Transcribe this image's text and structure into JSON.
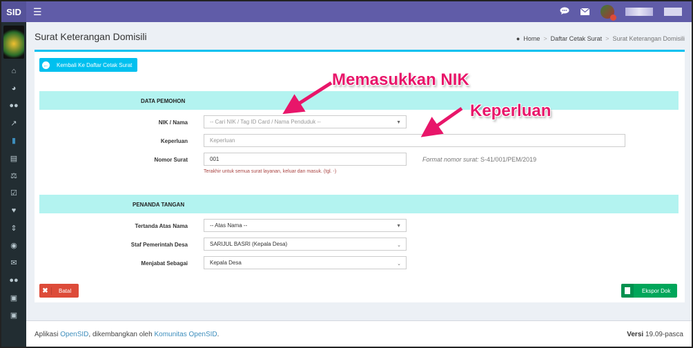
{
  "app": {
    "brand": "SID"
  },
  "colors": {
    "topbar": "#605ca8",
    "sidebar": "#222d32",
    "accent": "#00c0ef",
    "section": "#b3f3f0",
    "danger": "#dd4b39",
    "success": "#00a65a",
    "annotation": "#e8166a"
  },
  "topbar": {
    "icons": [
      "comments-icon",
      "envelope-icon",
      "user-avatar"
    ]
  },
  "sidebar": {
    "icons": [
      "home-icon",
      "dashboard-icon",
      "users-icon",
      "chart-icon",
      "book-icon",
      "list-icon",
      "balance-icon",
      "check-icon",
      "heart-icon",
      "signpost-icon",
      "globe-icon",
      "envelope-icon",
      "group-icon",
      "desktop-icon",
      "inbox-icon"
    ]
  },
  "page": {
    "title": "Surat Keterangan Domisili",
    "breadcrumb": {
      "home": "Home",
      "list": "Daftar Cetak Surat",
      "current": "Surat Keterangan Domisili",
      "sep": ">"
    }
  },
  "back_button": "Kembali Ke Daftar Cetak Surat",
  "section_pemohon": {
    "title": "DATA PEMOHON",
    "nik_label": "NIK / Nama",
    "nik_placeholder": "-- Cari NIK / Tag ID Card / Nama Penduduk --",
    "keperluan_label": "Keperluan",
    "keperluan_placeholder": "Keperluan",
    "nomor_label": "Nomor Surat",
    "nomor_value": "001",
    "nomor_help": "Terakhir untuk semua surat layanan, keluar dan masuk. (tgl. -)",
    "format_label": "Format nomor surat:",
    "format_value": "S-41/001/PEM/2019"
  },
  "section_penanda": {
    "title": "PENANDA TANGAN",
    "atas_nama_label": "Tertanda Atas Nama",
    "atas_nama_value": "-- Atas Nama --",
    "staf_label": "Staf Pemerintah Desa",
    "staf_value": "SARIJUL BASRI (Kepala Desa)",
    "jabatan_label": "Menjabat Sebagai",
    "jabatan_value": "Kepala Desa"
  },
  "actions": {
    "cancel": "Batal",
    "export": "Ekspor Dok"
  },
  "annotations": {
    "nik": "Memasukkan NIK",
    "keperluan": "Keperluan"
  },
  "footer": {
    "prefix": "Aplikasi",
    "app_link": "OpenSID",
    "middle": ", dikembangkan oleh",
    "community_link": "Komunitas OpenSID",
    "suffix": ".",
    "version_label": "Versi",
    "version_value": "19.09-pasca"
  }
}
